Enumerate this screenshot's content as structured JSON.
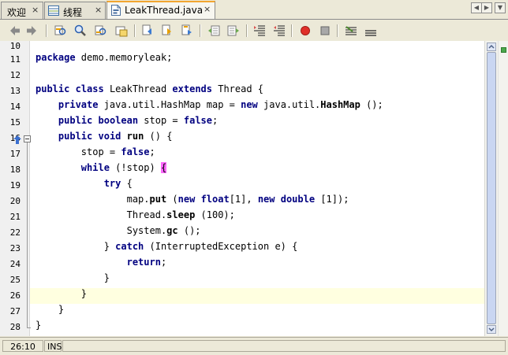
{
  "tabs": [
    {
      "label": "欢迎",
      "close": "×"
    },
    {
      "label": "线程",
      "close": "×"
    },
    {
      "label": "LeakThread.java",
      "close": "×"
    }
  ],
  "tab_nav": {
    "prev": "◀",
    "next": "▶",
    "menu": "▼"
  },
  "toolbar_icons": [
    "back-icon",
    "forward-icon",
    "find-prev-icon",
    "find-icon",
    "find-next-icon",
    "toggle-highlight-icon",
    "prev-bookmark-icon",
    "next-bookmark-icon",
    "toggle-bookmark-icon",
    "shift-left-icon",
    "shift-right-icon",
    "start-macro-icon",
    "stop-macro-icon",
    "comment-icon",
    "uncomment-icon",
    "indent-less-icon",
    "indent-more-icon"
  ],
  "editor": {
    "lines": [
      {
        "num": "10",
        "code": ""
      },
      {
        "num": "11",
        "code": "package demo.memoryleak;"
      },
      {
        "num": "12",
        "code": ""
      },
      {
        "num": "13",
        "code": "public class LeakThread extends Thread {"
      },
      {
        "num": "14",
        "code": "    private java.util.HashMap map = new java.util.HashMap ();"
      },
      {
        "num": "15",
        "code": "    public boolean stop = false;"
      },
      {
        "num": "16",
        "code": "    public void run () {"
      },
      {
        "num": "17",
        "code": "        stop = false;"
      },
      {
        "num": "18",
        "code": "        while (!stop) {"
      },
      {
        "num": "19",
        "code": "            try {"
      },
      {
        "num": "20",
        "code": "                map.put (new float[1], new double [1]);"
      },
      {
        "num": "21",
        "code": "                Thread.sleep (100);"
      },
      {
        "num": "22",
        "code": "                System.gc ();"
      },
      {
        "num": "23",
        "code": "            } catch (InterruptedException e) {"
      },
      {
        "num": "24",
        "code": "                return;"
      },
      {
        "num": "25",
        "code": "            }"
      },
      {
        "num": "26",
        "code": "        }"
      },
      {
        "num": "27",
        "code": "    }"
      },
      {
        "num": "28",
        "code": "}"
      }
    ],
    "current_line": "26"
  },
  "status": {
    "position": "26:10",
    "mode": "INS"
  },
  "colors": {
    "keyword": "#000080",
    "current_line": "#ffffe0",
    "brace_match": "#ff66ff",
    "tab_accent": "#f2a630"
  }
}
